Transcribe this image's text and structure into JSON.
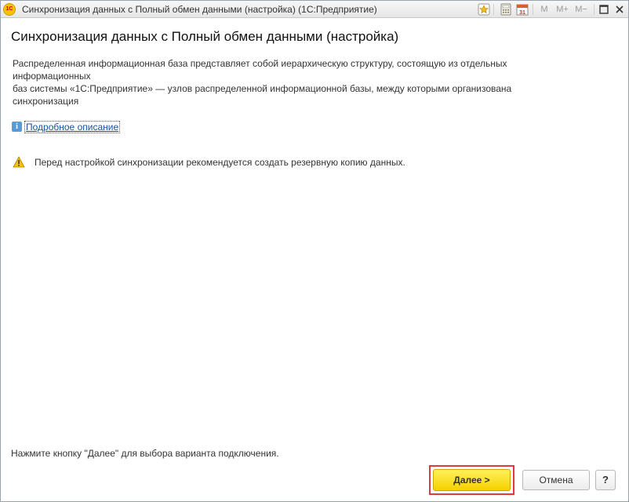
{
  "window": {
    "title": "Синхронизация данных с Полный обмен данными (настройка)  (1С:Предприятие)",
    "app_logo_text": "1С",
    "toolbar": {
      "m_label": "M",
      "mplus_label": "M+",
      "mminus_label": "M−"
    }
  },
  "main": {
    "heading": "Синхронизация данных с Полный обмен данными (настройка)",
    "description_lines": [
      "Распределенная информационная база представляет собой иерархическую структуру, состоящую из отдельных информационных",
      "баз системы «1С:Предприятие» — узлов распределенной информационной базы, между которыми организована синхронизация"
    ],
    "more_link": "Подробное описание",
    "warning_text": "Перед настройкой синхронизации рекомендуется создать резервную копию данных.",
    "hint_text": "Нажмите кнопку \"Далее\" для выбора варианта подключения."
  },
  "buttons": {
    "next": "Далее >",
    "cancel": "Отмена",
    "help": "?"
  },
  "colors": {
    "accent_yellow": "#f5d100",
    "highlight_red": "#e0393e",
    "link_blue": "#1b4fa3"
  }
}
